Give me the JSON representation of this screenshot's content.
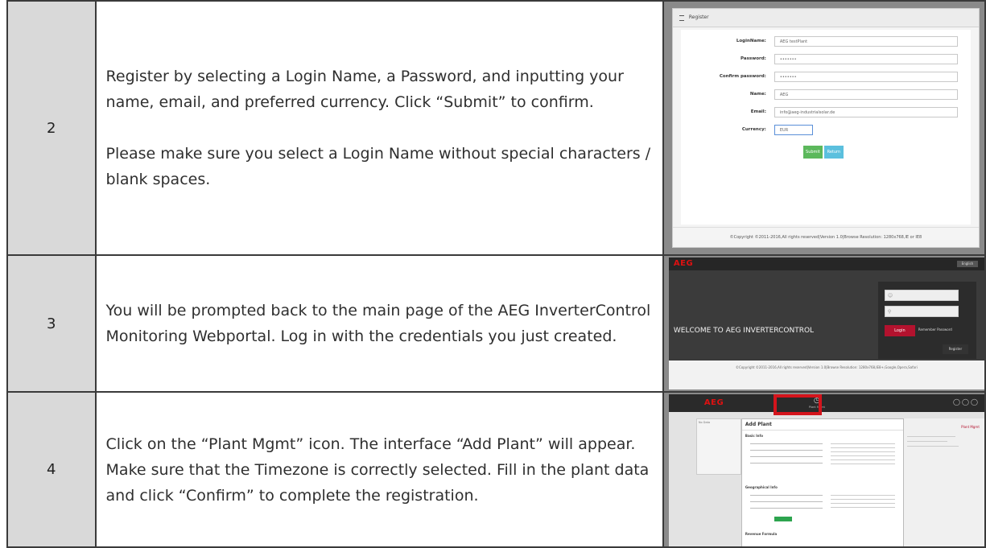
{
  "rows": [
    {
      "number": "2",
      "paragraphs": [
        "Register by selecting a Login Name, a Password, and inputting your name, email, and preferred currency. Click “Submit” to confirm.",
        "Please make sure you select a Login Name without special characters / blank spaces."
      ]
    },
    {
      "number": "3",
      "paragraphs": [
        "You will be prompted back to the main page of the AEG InverterControl Monitoring Webportal. Log in with the credentials you just created."
      ]
    },
    {
      "number": "4",
      "paragraphs": [
        "Click on the “Plant Mgmt” icon. The interface “Add Plant” will appear. Make sure that the Timezone is correctly selected. Fill in the plant data and click “Confirm” to complete the registration."
      ]
    }
  ],
  "register_shot": {
    "header": "Register",
    "fields": [
      {
        "label": "LoginName:",
        "value": "AEG testPlant"
      },
      {
        "label": "Password:",
        "value": "•••••••"
      },
      {
        "label": "Confirm password:",
        "value": "•••••••"
      },
      {
        "label": "Name:",
        "value": "AEG"
      },
      {
        "label": "Email:",
        "value": "info@aeg-industrialsolar.de"
      },
      {
        "label": "Currency:",
        "value": "EUR"
      }
    ],
    "submit": "Submit",
    "return": "Return",
    "footer": "©Copyright ©2011-2016,All rights reserved|Version 1.0|Browse Resolution: 1280x768,IE or IE8"
  },
  "login_shot": {
    "brand": "AEG",
    "language": "English",
    "welcome": "WELCOME TO AEG INVERTERCONTROL",
    "login": "Login",
    "remember": "Remember Password",
    "register": "Register",
    "footer": "©Copyright ©2011-2016,All rights reserved|Version 1.0|Browse Resolution: 1280x768,IE8+,Google,Opera,Safari"
  },
  "plant_shot": {
    "brand": "AEG",
    "mgmt_label": "Plant Mgmt",
    "dialog_title": "Add Plant",
    "section_basic": "Basic Info",
    "section_geo": "Geographical Info",
    "section_revenue": "Revenue Formula",
    "no_data": "No Data",
    "side_link": "Plant Mgmt"
  }
}
